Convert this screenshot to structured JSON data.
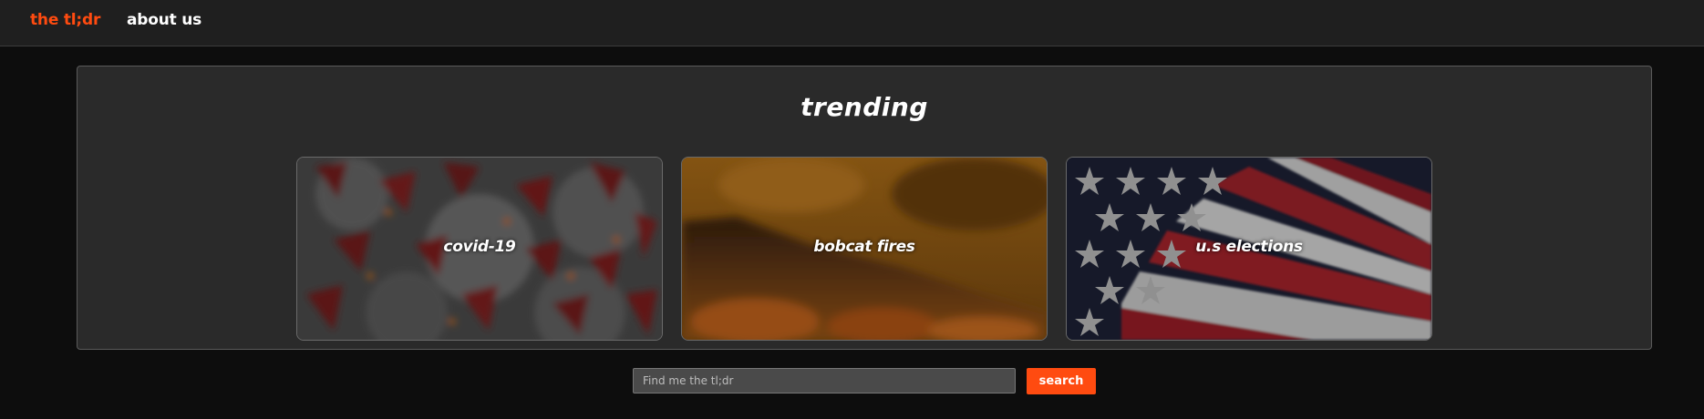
{
  "nav": {
    "brand": "the tl;dr",
    "about_label": "about us"
  },
  "trending": {
    "title": "trending",
    "cards": [
      {
        "label": "covid-19",
        "image": "coronavirus-image"
      },
      {
        "label": "bobcat fires",
        "image": "wildfire-image"
      },
      {
        "label": "u.s elections",
        "image": "american-flag-image"
      }
    ]
  },
  "search": {
    "placeholder": "Find me the tl;dr",
    "value": "",
    "button_label": "search"
  },
  "colors": {
    "accent": "#ff4b10",
    "background": "#0d0d0d",
    "navbar": "#1f1f1f",
    "panel": "#2a2a2a"
  }
}
